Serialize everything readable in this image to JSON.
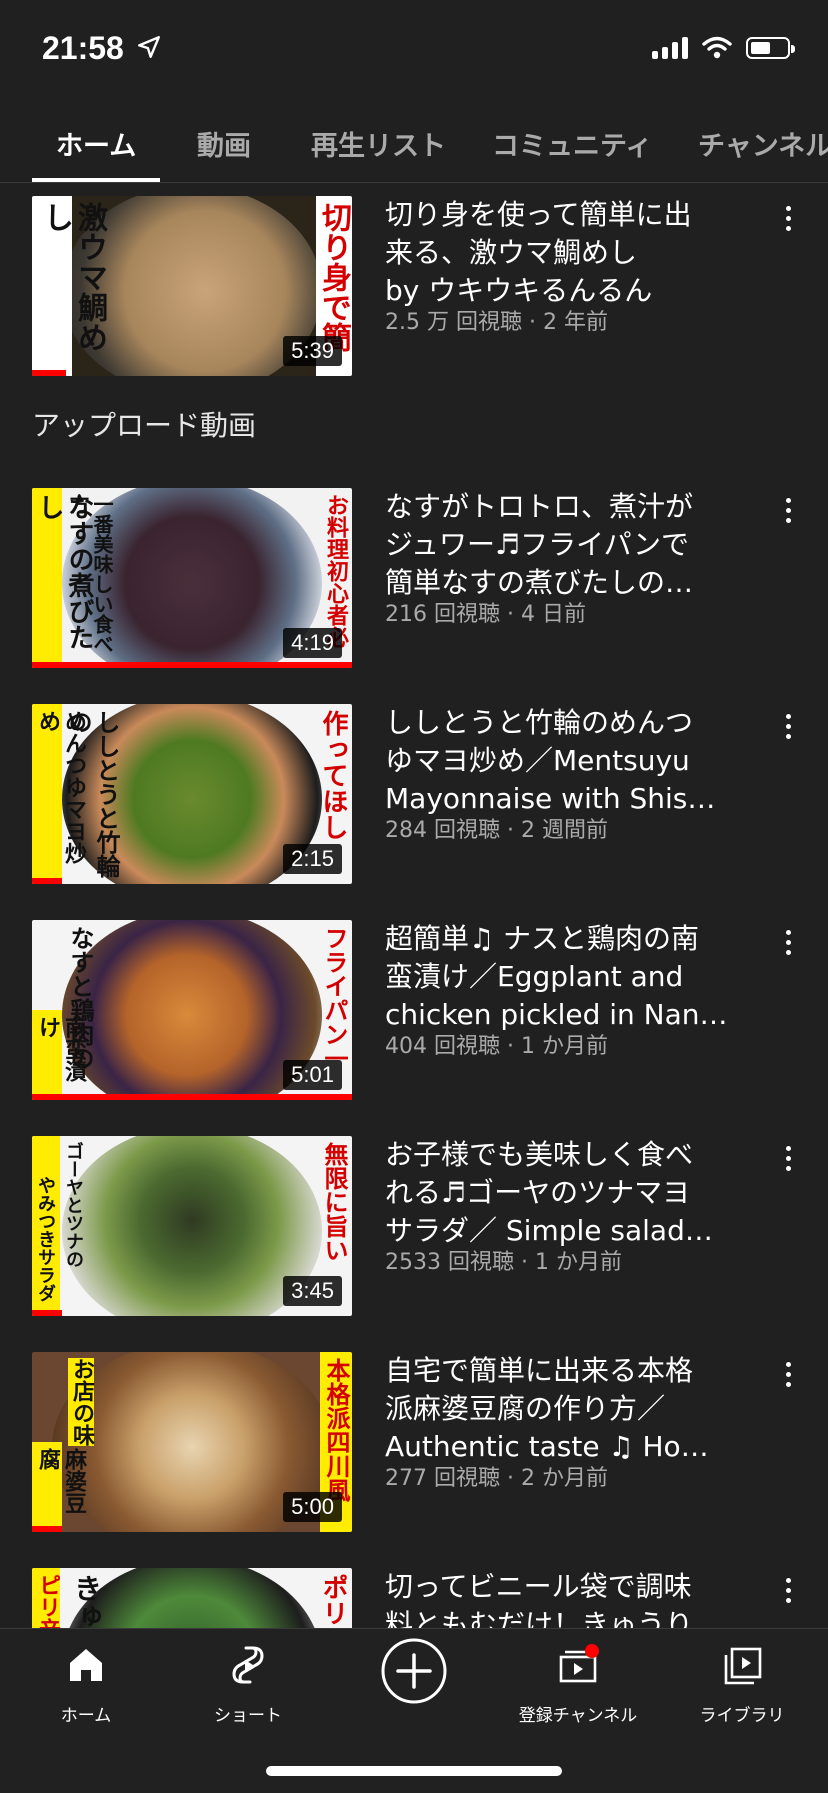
{
  "status_bar": {
    "time": "21:58"
  },
  "tabs": [
    "ホーム",
    "動画",
    "再生リスト",
    "コミュニティ",
    "チャンネル"
  ],
  "featured": {
    "title_lines": [
      "切り身を使って簡単に出",
      "来る、激ウマ鯛めし",
      "by ウキウキるんるん"
    ],
    "meta": "2.5 万 回視聴 · 2 年前",
    "duration": "5:39",
    "thumb_left_text": "激ウマ鯛めし",
    "thumb_right_text": "切り身で簡"
  },
  "section_title": "アップロード動画",
  "videos": [
    {
      "title_lines": [
        "なすがトロトロ、煮汁が",
        "ジュワー♬フライパンで",
        "簡単なすの煮びたしの…"
      ],
      "meta": "216 回視聴 · 4 日前",
      "duration": "4:19",
      "thumb_left_text": "なすの煮びたし",
      "thumb_left2_text": "一番美味しい食べ方",
      "thumb_right_text": "お料理初心者必"
    },
    {
      "title_lines": [
        "ししとうと竹輪のめんつ",
        "ゆマヨ炒め／Mentsuyu",
        "Mayonnaise with Shis…"
      ],
      "meta": "284 回視聴 · 2 週間前",
      "duration": "2:15",
      "thumb_left_text": "めんつゆマヨ炒め",
      "thumb_left2_text": "ししとうと竹輪の",
      "thumb_right_text": "作ってほし"
    },
    {
      "title_lines": [
        "超簡単♫ ナスと鶏肉の南",
        "蛮漬け／Eggplant and",
        "chicken pickled in Nan…"
      ],
      "meta": "404 回視聴 · 1 か月前",
      "duration": "5:01",
      "thumb_left_text": "南蛮漬け",
      "thumb_left2_text": "なすと鶏肉の",
      "thumb_right_text": "フライパン一"
    },
    {
      "title_lines": [
        "お子様でも美味しく食べ",
        "れる♬ゴーヤのツナマヨ",
        "サラダ／ Simple salad…"
      ],
      "meta": "2533 回視聴 · 1 か月前",
      "duration": "3:45",
      "thumb_left_text": "やみつきサラダ",
      "thumb_left2_text": "ゴーヤとツナの",
      "thumb_right_text": "無限に旨い"
    },
    {
      "title_lines": [
        "自宅で簡単に出来る本格",
        "派麻婆豆腐の作り方／",
        "Authentic taste ♫ Ho…"
      ],
      "meta": "277 回視聴 · 2 か月前",
      "duration": "5:00",
      "thumb_left_text": "麻婆豆腐",
      "thumb_left2_text": "お店の味",
      "thumb_right_text": "本格派四川風"
    },
    {
      "title_lines": [
        "切ってビニール袋で調味",
        "料ともむだけ！きゅうり"
      ],
      "meta": "",
      "duration": "",
      "thumb_left_text": "ピリ辛",
      "thumb_left2_text": "きゅ",
      "thumb_right_text": "ポリ"
    }
  ],
  "bottom_nav": [
    {
      "label": "ホーム",
      "icon": "home-icon"
    },
    {
      "label": "ショート",
      "icon": "shorts-icon"
    },
    {
      "label": "",
      "icon": "create-icon"
    },
    {
      "label": "登録チャンネル",
      "icon": "subscriptions-icon"
    },
    {
      "label": "ライブラリ",
      "icon": "library-icon"
    }
  ],
  "colors": {
    "background": "#202020",
    "accent": "#ff0000",
    "secondary_text": "#aaaaaa"
  }
}
